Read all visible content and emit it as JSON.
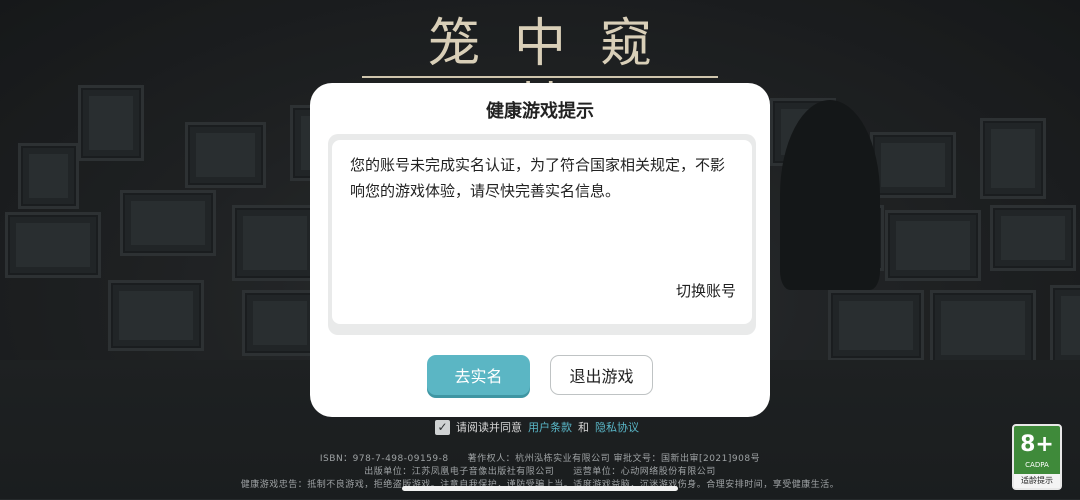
{
  "game": {
    "title": "笼中窥梦"
  },
  "dialog": {
    "title": "健康游戏提示",
    "message": "您的账号未完成实名认证，为了符合国家相关规定，不影响您的游戏体验，请尽快完善实名信息。",
    "switch_account": "切换账号",
    "primary_button": "去实名",
    "secondary_button": "退出游戏"
  },
  "agreement": {
    "prefix": "请阅读并同意",
    "terms_link": "用户条款",
    "and": "和",
    "privacy_link": "隐私协议"
  },
  "footer": {
    "line1": "ISBN：978-7-498-09159-8　　著作权人：杭州泓栋实业有限公司 审批文号：国新出审[2021]908号",
    "line2": "出版单位：江苏凤凰电子音像出版社有限公司　　运营单位：心动网络股份有限公司",
    "line3": "健康游戏忠告：抵制不良游戏，拒绝盗版游戏。注意自我保护，谨防受骗上当。适度游戏益脑，沉迷游戏伤身。合理安排时间，享受健康生活。"
  },
  "age_rating": {
    "number": "8+",
    "org": "CADPA",
    "label": "适龄提示"
  }
}
